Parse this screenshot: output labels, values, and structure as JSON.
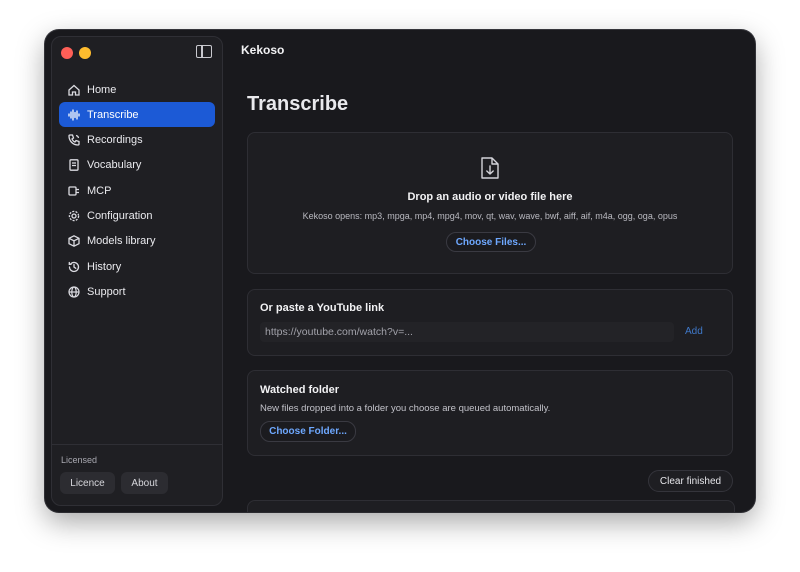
{
  "app": {
    "title": "Kekoso"
  },
  "sidebar": {
    "items": [
      {
        "label": "Home",
        "icon": "home-icon"
      },
      {
        "label": "Transcribe",
        "icon": "waveform-icon",
        "active": true
      },
      {
        "label": "Recordings",
        "icon": "phone-icon"
      },
      {
        "label": "Vocabulary",
        "icon": "book-icon"
      },
      {
        "label": "MCP",
        "icon": "plug-icon"
      },
      {
        "label": "Configuration",
        "icon": "gear-icon"
      },
      {
        "label": "Models library",
        "icon": "cube-icon"
      },
      {
        "label": "History",
        "icon": "history-icon"
      },
      {
        "label": "Support",
        "icon": "globe-icon"
      }
    ],
    "footer": {
      "licensed_label": "Licensed",
      "licence_button": "Licence",
      "about_button": "About"
    }
  },
  "main": {
    "title": "Transcribe",
    "drop_zone": {
      "title": "Drop an audio or video file here",
      "formats": "Kekoso opens: mp3, mpga, mp4, mpg4, mov, qt, wav, wave, bwf, aiff, aif, m4a, ogg, oga, opus",
      "button": "Choose Files..."
    },
    "youtube": {
      "title": "Or paste a YouTube link",
      "placeholder": "https://youtube.com/watch?v=...",
      "add_label": "Add"
    },
    "watched_folder": {
      "title": "Watched folder",
      "description": "New files dropped into a folder you choose are queued automatically.",
      "button": "Choose Folder..."
    },
    "clear_finished": "Clear finished"
  },
  "colors": {
    "accent": "#1c5ad6",
    "link": "#6ea8ff",
    "window_bg": "#19191d"
  }
}
